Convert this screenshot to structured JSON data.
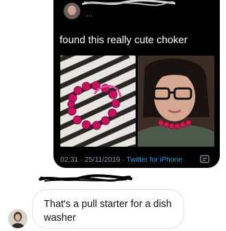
{
  "tweet": {
    "handle": "...",
    "text": "found this really cute choker",
    "time": "02:31 · 25/11/2019 · ",
    "source": "Twitter for iPhone"
  },
  "reply": {
    "text": "That's a pull starter for a dish washer"
  },
  "colors": {
    "tweet_bg": "#000000",
    "link": "#1da1f2",
    "meta": "#8899a6",
    "choker": "#d0176a"
  },
  "icons": [
    "user-avatar-icon",
    "redaction-scribble-icon",
    "tweet-share-icon",
    "reply-avatar-icon"
  ]
}
